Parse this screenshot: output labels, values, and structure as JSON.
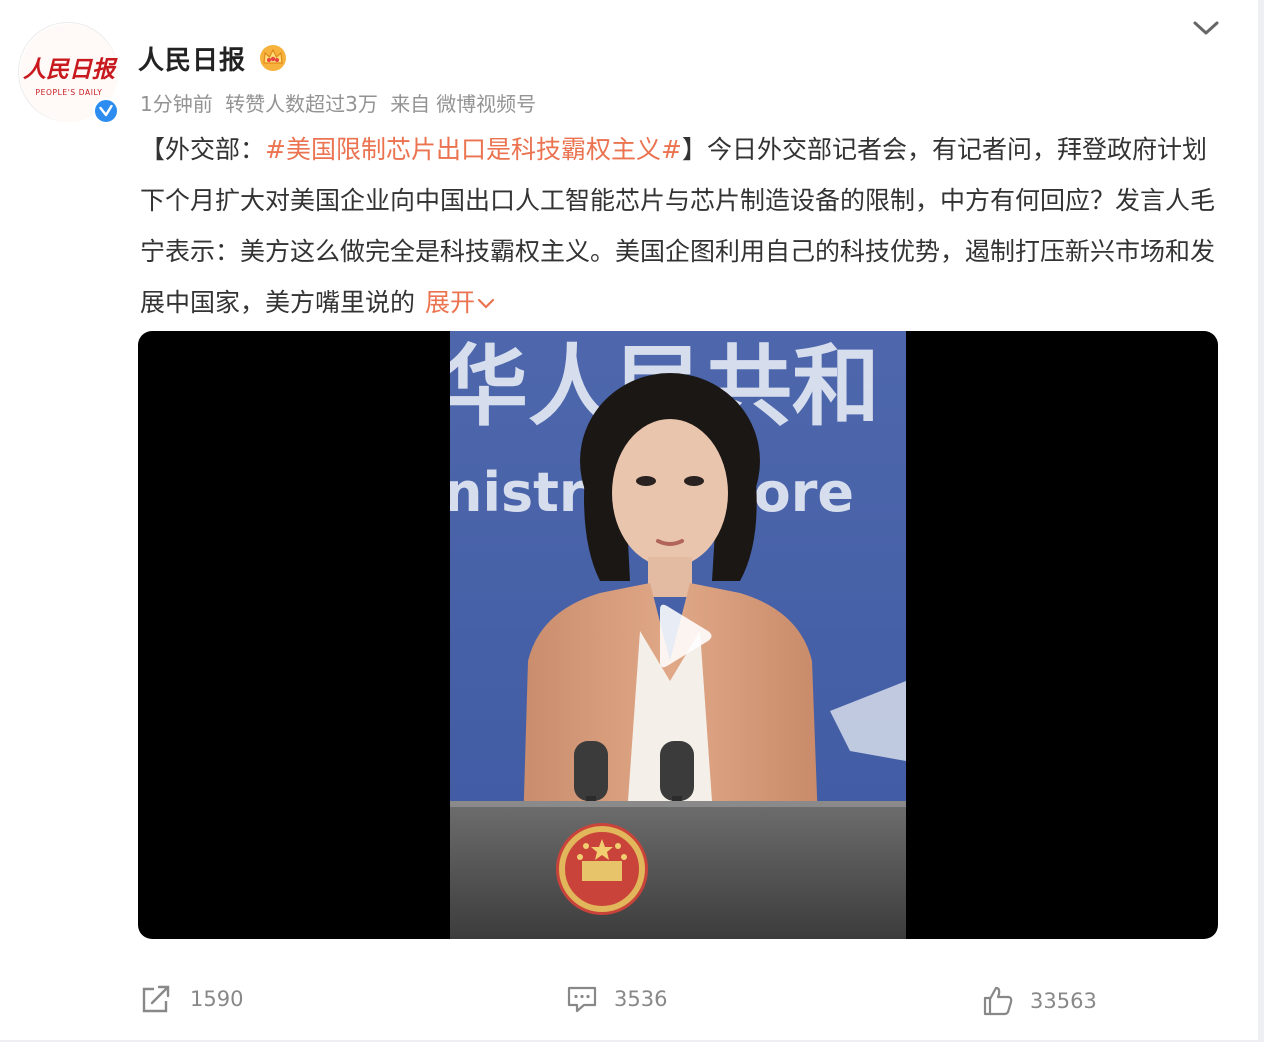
{
  "account": {
    "name": "人民日报",
    "avatar_text_cn": "人民日报",
    "avatar_text_en": "PEOPLE'S DAILY",
    "badge_icon": "crown-icon",
    "verified_icon": "verified-icon"
  },
  "meta": {
    "time": "1分钟前",
    "reposts_info": "转赞人数超过3万",
    "source_prefix": "来自",
    "source": "微博视频号"
  },
  "post": {
    "bracket_open": "【外交部：",
    "topic": "#美国限制芯片出口是科技霸权主义#",
    "bracket_close": "】",
    "body": "今日外交部记者会，有记者问，拜登政府计划下个月扩大对美国企业向中国出口人工智能芯片与芯片制造设备的限制，中方有何回应？发言人毛宁表示：美方这么做完全是科技霸权主义。美国企图利用自己的科技优势，遏制打压新兴市场和发展中国家，美方嘴里说的",
    "expand_label": "展开"
  },
  "video": {
    "backdrop_cn": "华人民共和",
    "backdrop_en": "nistry of Fore",
    "play_icon": "play-icon"
  },
  "actions": {
    "repost_count": "1590",
    "comment_count": "3536",
    "like_count": "33563"
  },
  "colors": {
    "accent": "#eb7350",
    "meta_gray": "#939393",
    "verified_blue": "#2d8cf0"
  }
}
